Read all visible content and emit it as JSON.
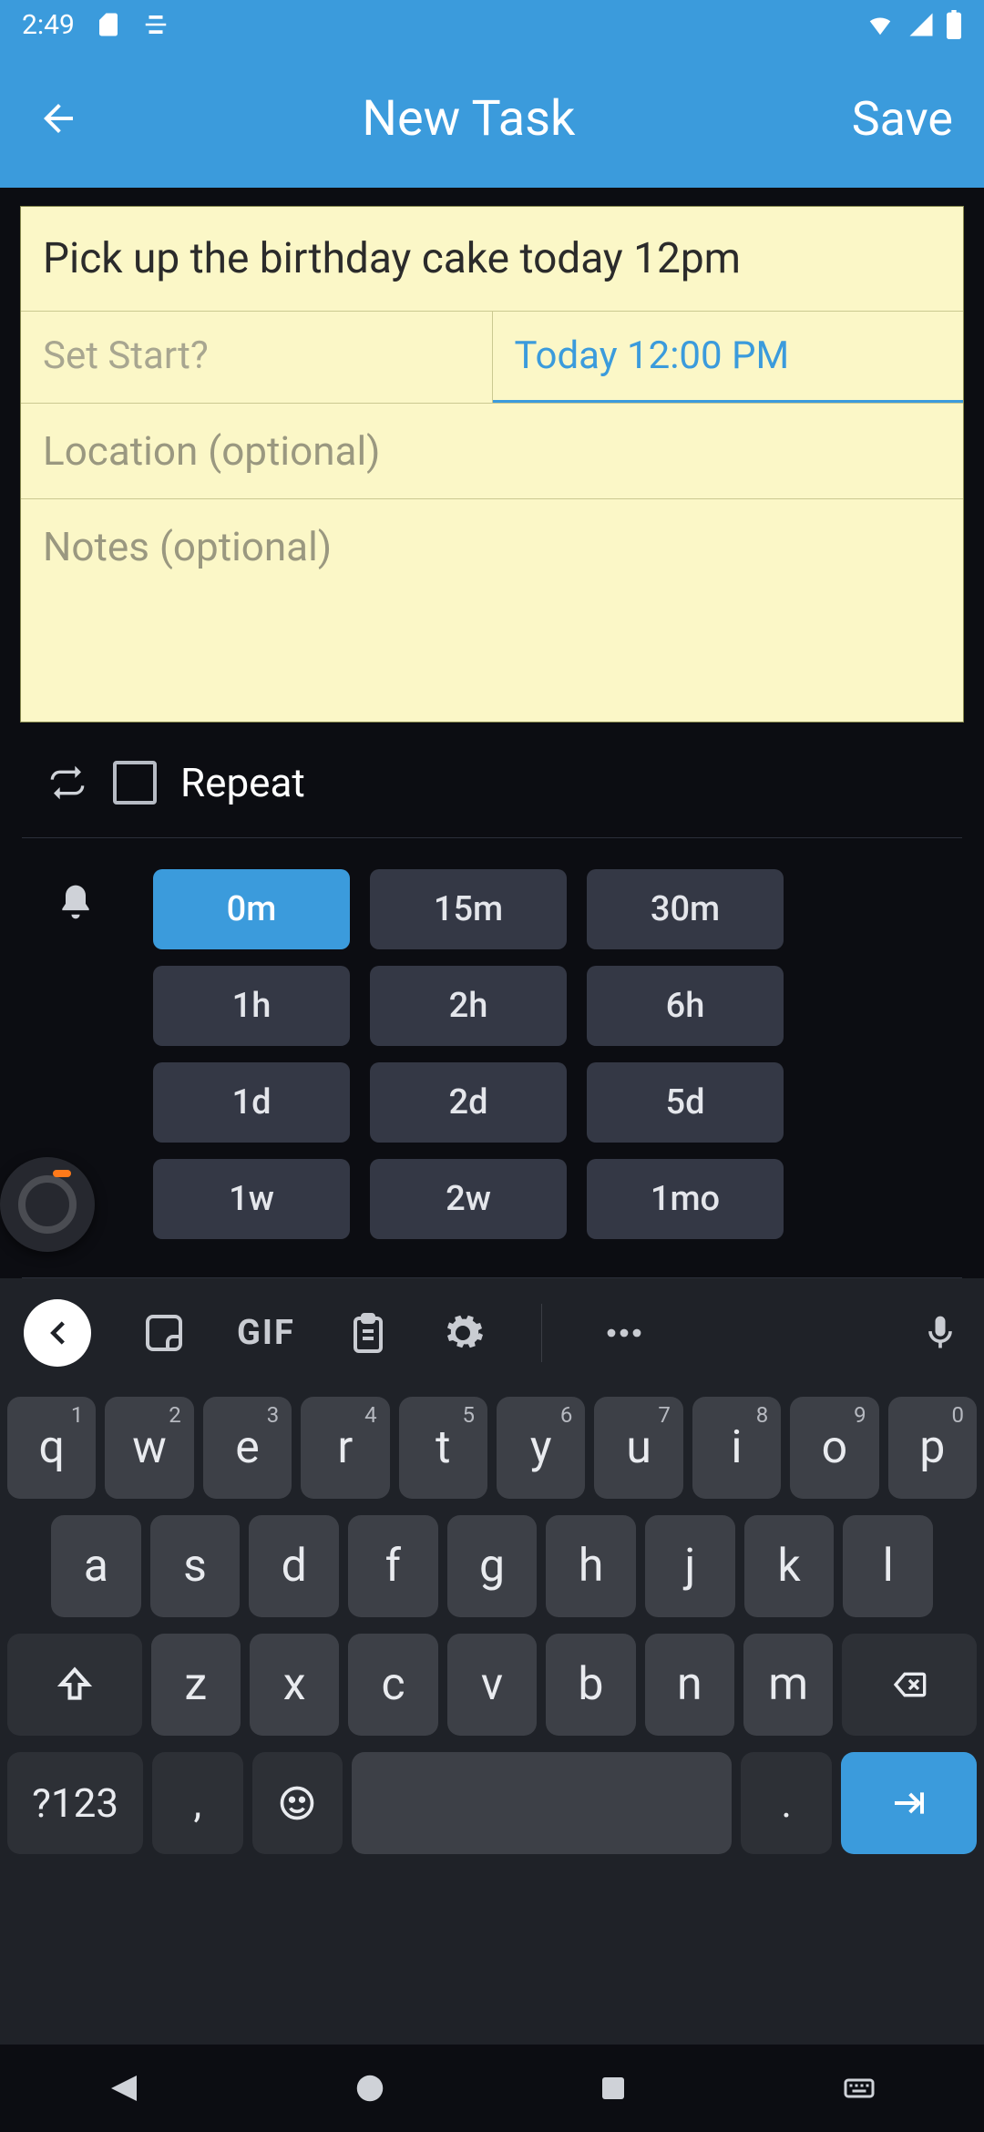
{
  "status": {
    "time": "2:49"
  },
  "appbar": {
    "title": "New Task",
    "save": "Save"
  },
  "task": {
    "title_value": "Pick up the birthday cake today 12pm",
    "start_placeholder": "Set Start?",
    "due_value": "Today 12:00 PM",
    "location_placeholder": "Location (optional)",
    "notes_placeholder": "Notes (optional)"
  },
  "repeat": {
    "label": "Repeat",
    "checked": false
  },
  "reminders": {
    "selected": "0m",
    "options": [
      "0m",
      "15m",
      "30m",
      "1h",
      "2h",
      "6h",
      "1d",
      "2d",
      "5d",
      "1w",
      "2w",
      "1mo"
    ]
  },
  "keyboard": {
    "gif_label": "GIF",
    "symbols_label": "?123",
    "row1": [
      {
        "k": "q",
        "n": "1"
      },
      {
        "k": "w",
        "n": "2"
      },
      {
        "k": "e",
        "n": "3"
      },
      {
        "k": "r",
        "n": "4"
      },
      {
        "k": "t",
        "n": "5"
      },
      {
        "k": "y",
        "n": "6"
      },
      {
        "k": "u",
        "n": "7"
      },
      {
        "k": "i",
        "n": "8"
      },
      {
        "k": "o",
        "n": "9"
      },
      {
        "k": "p",
        "n": "0"
      }
    ],
    "row2": [
      "a",
      "s",
      "d",
      "f",
      "g",
      "h",
      "j",
      "k",
      "l"
    ],
    "row3": [
      "z",
      "x",
      "c",
      "v",
      "b",
      "n",
      "m"
    ],
    "comma": ",",
    "period": "."
  }
}
